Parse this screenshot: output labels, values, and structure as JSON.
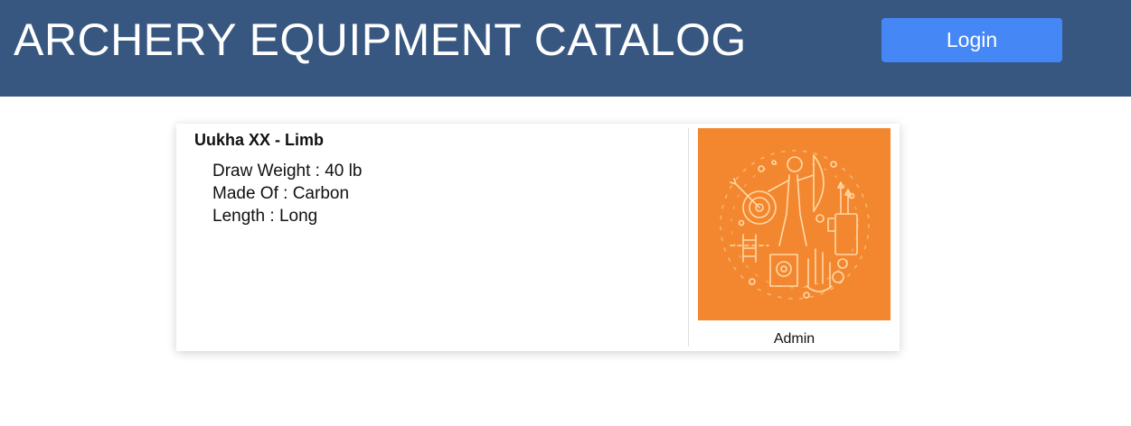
{
  "header": {
    "title": "ARCHERY EQUIPMENT CATALOG",
    "login_label": "Login",
    "background_color": "#375781",
    "button_color": "#4587f5"
  },
  "item": {
    "title": "Uukha XX - Limb",
    "specs": [
      "Draw Weight : 40 lb",
      "Made Of : Carbon",
      "Length : Long"
    ],
    "image": {
      "icon": "archery-illustration-icon",
      "background_color": "#f3872f"
    },
    "owner": "Admin"
  }
}
